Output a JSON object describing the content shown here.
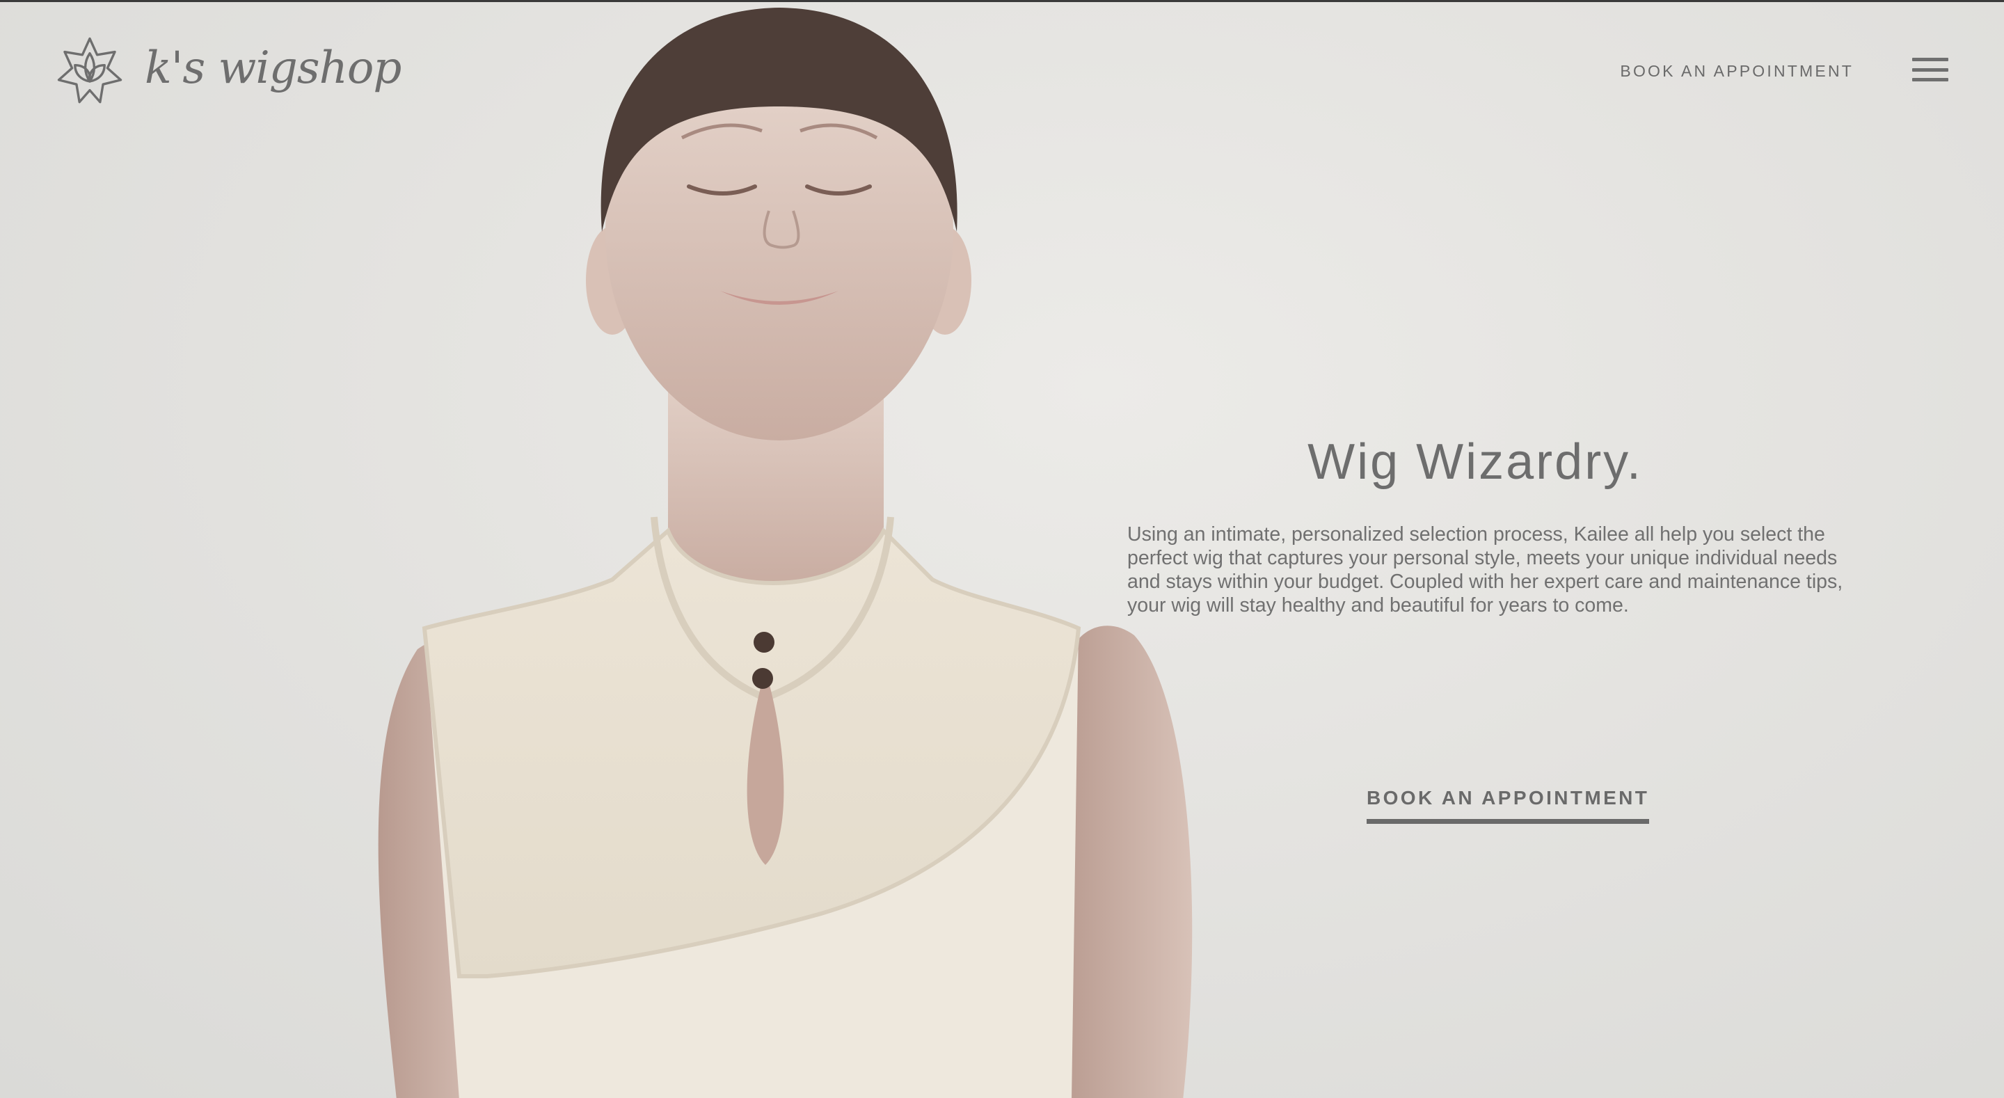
{
  "brand": {
    "name": "k's wigshop",
    "logo_icon": "lotus-icon"
  },
  "header": {
    "book_link": "BOOK AN APPOINTMENT",
    "menu_icon": "hamburger-menu-icon"
  },
  "hero": {
    "headline": "Wig Wizardry.",
    "description": "Using an intimate, personalized selection process, Kailee all help you select the perfect wig that captures your personal style, meets your unique individual needs and stays within your budget. Coupled with her expert care and maintenance tips, your wig will stay healthy and beautiful for years to come.",
    "cta_label": "BOOK AN APPOINTMENT"
  },
  "colors": {
    "background": "#e4e3e0",
    "text": "#6d6d6d",
    "top_border": "#3a3a3a"
  }
}
